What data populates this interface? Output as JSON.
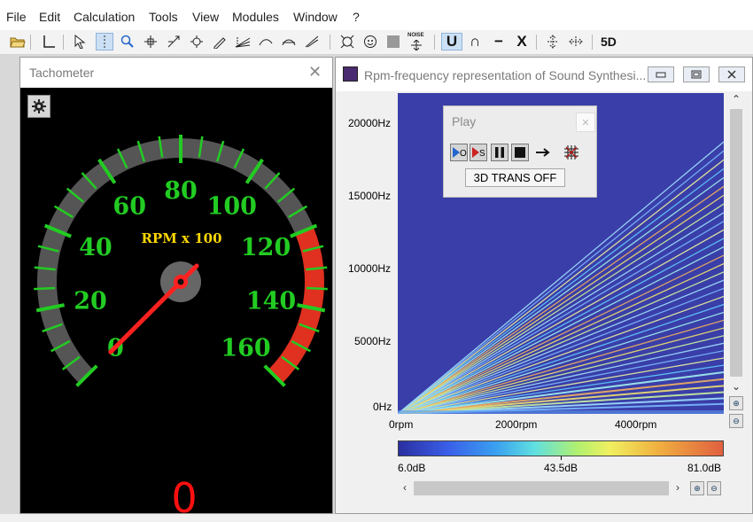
{
  "menu": [
    "File",
    "Edit",
    "Calculation",
    "Tools",
    "View",
    "Modules",
    "Window",
    "?"
  ],
  "toolbar": {
    "noise_label": "NOISE",
    "union_label": "U",
    "intersect_label": "∩",
    "minus_label": "−",
    "cross_label": "X",
    "fiveD_label": "5D"
  },
  "tachometer": {
    "title": "Tachometer",
    "close_icon": "close-icon",
    "gear_icon": "gear-icon",
    "dial_label": "RPM x 100",
    "scale": [
      "0",
      "20",
      "40",
      "60",
      "80",
      "100",
      "120",
      "140",
      "160"
    ],
    "value": "0",
    "colors": {
      "ticks": "#22cc22",
      "numbers": "#22cc22",
      "label": "#ffd700",
      "redzone": "#e03020",
      "needle": "#ff2020",
      "digital": "#ff1010",
      "arc": "#555555"
    }
  },
  "spectrogram": {
    "title": "Rpm-frequency representation of Sound Synthesi...",
    "y_ticks": [
      "20000Hz",
      "15000Hz",
      "10000Hz",
      "5000Hz",
      "0Hz"
    ],
    "x_ticks": [
      "0rpm",
      "2000rpm",
      "4000rpm"
    ],
    "colorbar_labels": [
      "6.0dB",
      "43.5dB",
      "81.0dB"
    ],
    "colors": {
      "background": "#3a3ea8"
    }
  },
  "play_dialog": {
    "title": "Play",
    "buttons": [
      "play-o",
      "play-s",
      "pause",
      "stop",
      "arrow",
      "grid"
    ],
    "play_o_label": "O",
    "play_s_label": "S",
    "trans_button": "3D TRANS OFF"
  }
}
